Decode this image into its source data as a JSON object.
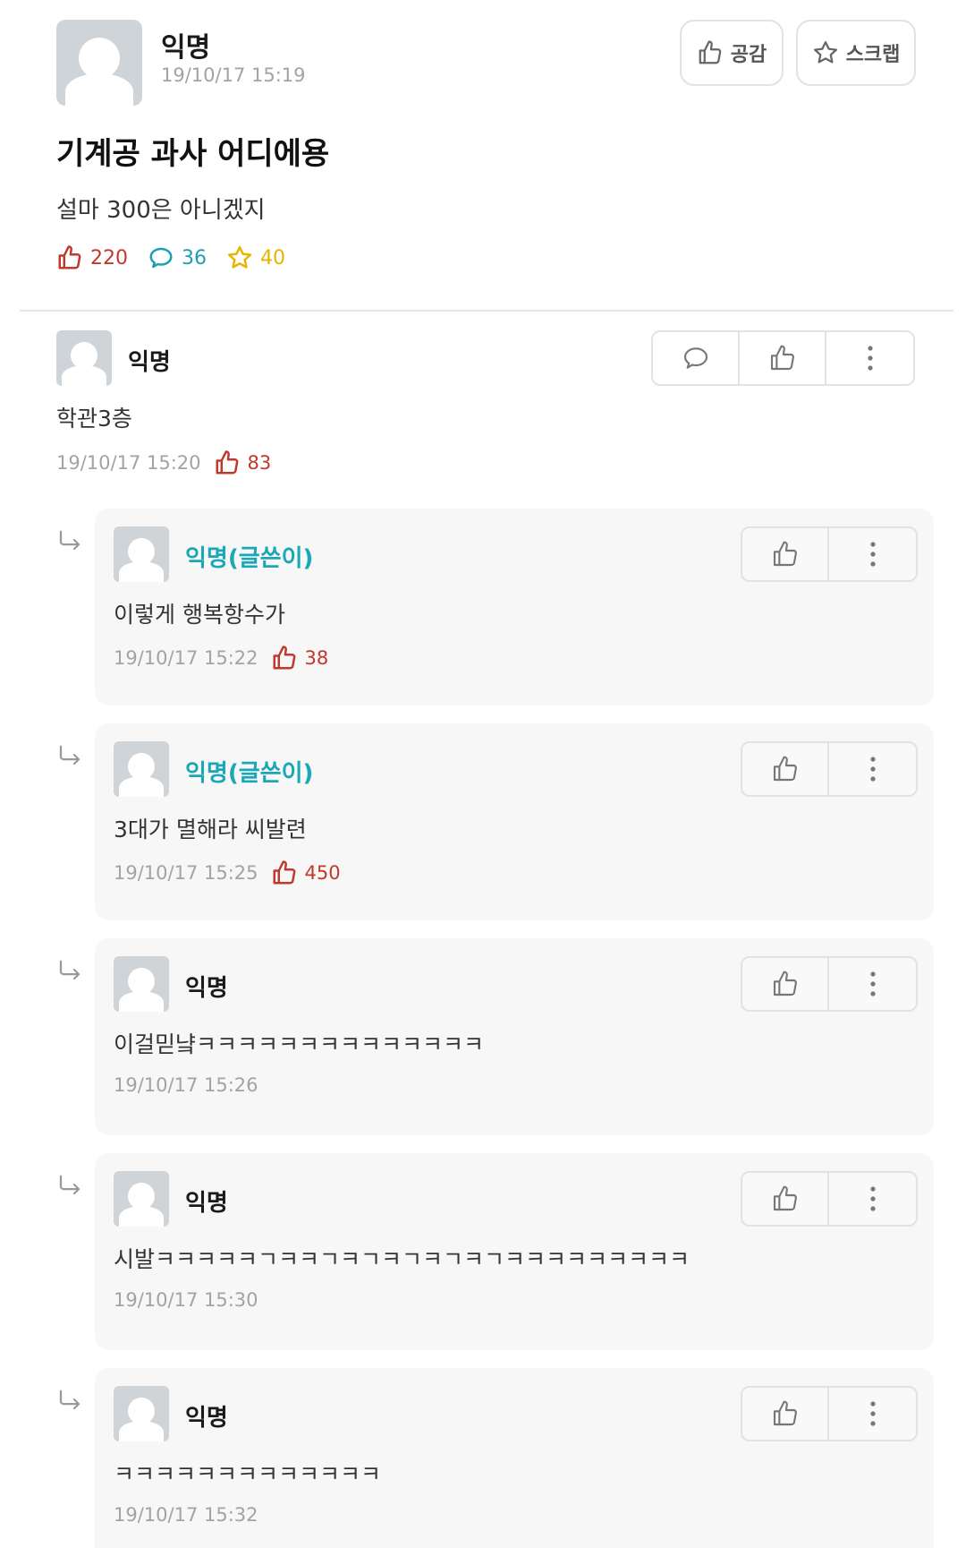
{
  "article": {
    "author": "익명",
    "time": "19/10/17 15:19",
    "like_button_label": "공감",
    "scrap_button_label": "스크랩",
    "title": "기계공 과사 어디에용",
    "body": "설마 300은 아니겠지",
    "stats": {
      "likes": "220",
      "comments": "36",
      "scraps": "40"
    }
  },
  "comment": {
    "author": "익명",
    "text": "학관3층",
    "time": "19/10/17 15:20",
    "likes": "83"
  },
  "replies": [
    {
      "author": "익명(글쓴이)",
      "is_op": true,
      "text": "이렇게 행복항수가",
      "time": "19/10/17 15:22",
      "likes": "38"
    },
    {
      "author": "익명(글쓴이)",
      "is_op": true,
      "text": "3대가 멸해라 씨발련",
      "time": "19/10/17 15:25",
      "likes": "450"
    },
    {
      "author": "익명",
      "is_op": false,
      "text": "이걸믿냨ㅋㅋㅋㅋㅋㅋㅋㅋㅋㅋㅋㅋㅋㅋ",
      "time": "19/10/17 15:26",
      "likes": ""
    },
    {
      "author": "익명",
      "is_op": false,
      "text": "시발ㅋㅋㅋㅋㅋㄱㅋㅋㄱㅋㄱㅋㄱㅋㄱㅋㄱㅋㅋㅋㅋㅋㅋㅋㅋㅋ",
      "time": "19/10/17 15:30",
      "likes": ""
    },
    {
      "author": "익명",
      "is_op": false,
      "text": "ㅋㅋㅋㅋㅋㅋㅋㅋㅋㅋㅋㅋㅋ",
      "time": "19/10/17 15:32",
      "likes": ""
    }
  ],
  "colors": {
    "like": "#c0392b",
    "comment": "#1e9fb5",
    "scrap": "#e8b400",
    "op_author": "#1ba7b6"
  },
  "icons": {
    "like": "thumbs-up-icon",
    "comment": "speech-bubble-icon",
    "scrap": "star-icon",
    "more": "more-vertical-icon",
    "reply": "reply-arrow-icon"
  }
}
